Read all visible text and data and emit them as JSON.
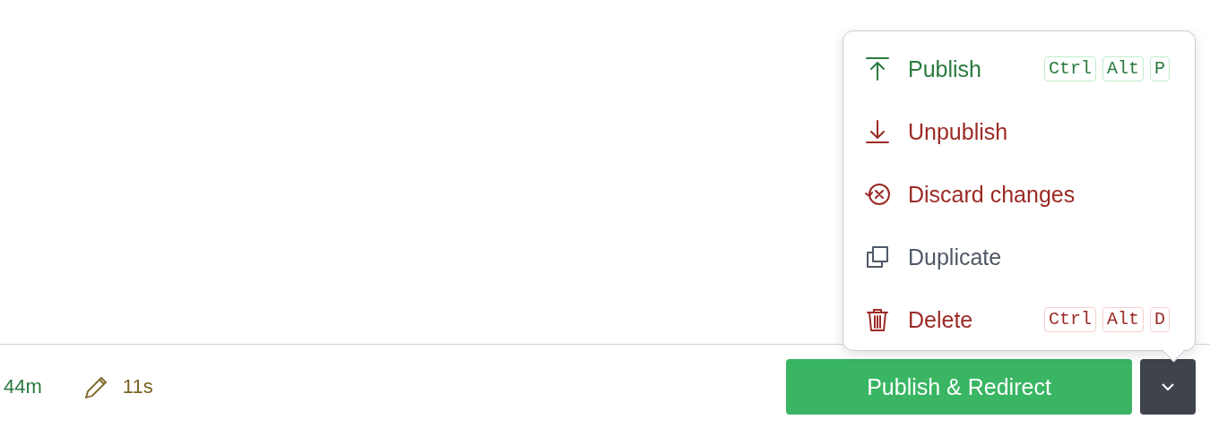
{
  "menu": {
    "items": [
      {
        "kind": "publish",
        "label": "Publish",
        "shortcut": [
          "Ctrl",
          "Alt",
          "P"
        ]
      },
      {
        "kind": "unpublish",
        "label": "Unpublish"
      },
      {
        "kind": "discard",
        "label": "Discard changes"
      },
      {
        "kind": "duplicate",
        "label": "Duplicate"
      },
      {
        "kind": "delete",
        "label": "Delete",
        "shortcut": [
          "Ctrl",
          "Alt",
          "D"
        ]
      }
    ]
  },
  "status": [
    {
      "kind": "age",
      "text": "44m"
    },
    {
      "kind": "edited",
      "text": "11s"
    }
  ],
  "primary_button": {
    "label": "Publish & Redirect"
  }
}
